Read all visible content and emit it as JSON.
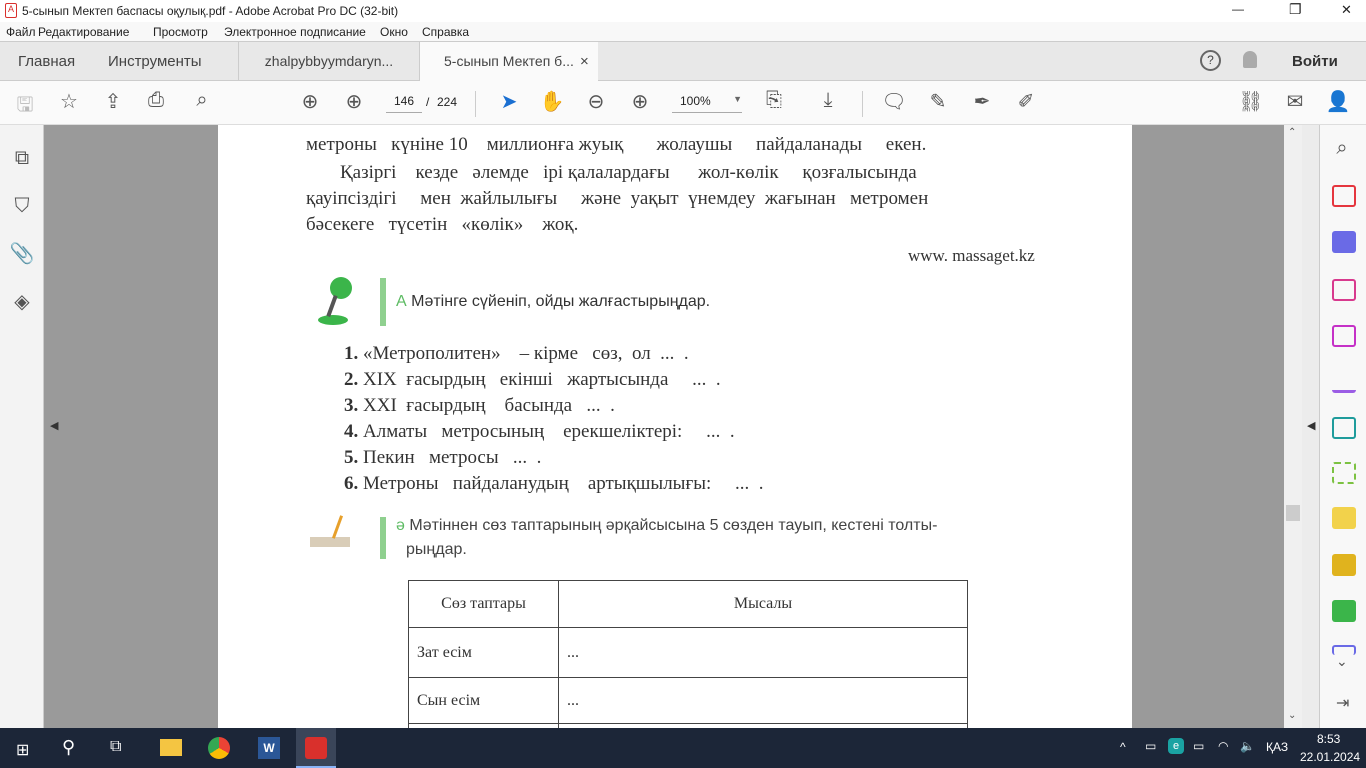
{
  "window": {
    "title": "5-сынып Мектеп баспасы оқулық.pdf - Adobe Acrobat Pro DC (32-bit)",
    "minimize": "—",
    "restore": "❐",
    "close": "✕"
  },
  "menu": [
    "Файл",
    "Редактирование",
    "Просмотр",
    "Электронное подписание",
    "Окно",
    "Справка"
  ],
  "tabs": {
    "home": "Главная",
    "tools": "Инструменты",
    "doc1": "zhalpybbyymdaryn...",
    "doc2": "5-сынып Мектеп б...",
    "close": "×",
    "signin": "Войти"
  },
  "toolbar": {
    "page_current": "146",
    "page_sep": "/",
    "page_total": "224",
    "zoom": "100%"
  },
  "page": {
    "text_lines": [
      "метроны   күніне 10    миллионға жуық       жолаушы     пайдаланады     екен.",
      "Қазіргі    кезде   әлемде   ірі қалалардағы      жол-көлік     қозғалысында",
      "қауіпсіздігі     мен  жайлылығы     және  уақыт  үнемдеу  жағынан   метромен",
      "бәсекеге   түсетін   «көлік»    жоқ."
    ],
    "source": "www. massaget.kz",
    "task_a": {
      "letter": "А",
      "text": "Мәтінге сүйеніп, ойды жалғастырыңдар."
    },
    "items": [
      {
        "n": "1.",
        "text": "«Метрополитен»    – кірме   сөз,  ол  ...  ."
      },
      {
        "n": "2.",
        "text": "XIX  ғасырдың   екінші   жартысында     ...  ."
      },
      {
        "n": "3.",
        "text": "XXI  ғасырдың    басында   ...  ."
      },
      {
        "n": "4.",
        "text": "Алматы   метросының    ерекшеліктері:     ...  ."
      },
      {
        "n": "5.",
        "text": "Пекин   метросы   ...  ."
      },
      {
        "n": "6.",
        "text": "Метроны   пайдаланудың    артықшылығы:     ...  ."
      }
    ],
    "task_ae": {
      "letter": "ә",
      "line1": "Мәтіннен сөз таптарының әрқайсысына 5 сөзден тауып, кестені толты-",
      "line2": "рыңдар."
    },
    "table": {
      "headers": [
        "Сөз  таптары",
        "Мысалы"
      ],
      "rows": [
        [
          "Зат   есім",
          "..."
        ],
        [
          "Сын  есім",
          "..."
        ]
      ]
    }
  },
  "tray": {
    "lang": "ҚАЗ",
    "time": "8:53",
    "date": "22.01.2024"
  },
  "colors": {
    "taskbar": "#1c2638",
    "accent_green": "#5dbb63",
    "acrobat_red": "#d9302c"
  }
}
